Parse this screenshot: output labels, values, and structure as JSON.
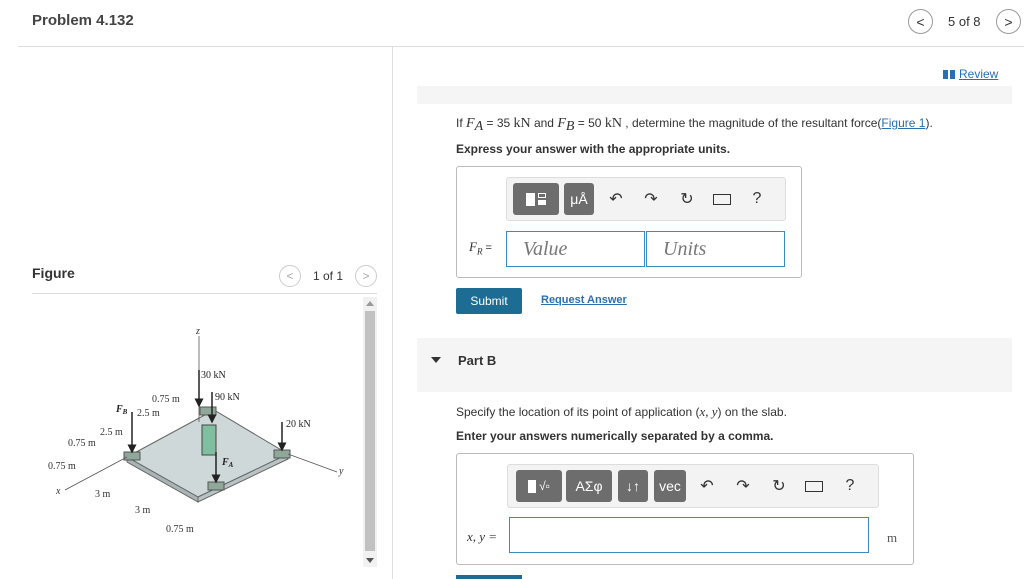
{
  "header": {
    "title": "Problem 4.132",
    "page_indicator": "5 of 8",
    "prev_glyph": "<",
    "next_glyph": ">"
  },
  "figure_panel": {
    "title": "Figure",
    "count": "1 of 1",
    "labels": {
      "z": "z",
      "x": "x",
      "y": "y",
      "f30": "30 kN",
      "f90": "90 kN",
      "f20": "20 kN",
      "fb": "F",
      "fb_sub": "B",
      "fa": "F",
      "fa_sub": "A",
      "d075a": "0.75 m",
      "d25a": "2.5 m",
      "d25b": "2.5 m",
      "d075b": "0.75 m",
      "d075c": "0.75 m",
      "d3a": "3 m",
      "d3b": "3 m",
      "d075d": "0.75 m"
    }
  },
  "review": {
    "label": "Review"
  },
  "part_a": {
    "q_if": "If ",
    "fa_sym": "F",
    "fa_sub": "A",
    "q_eq1": " = 35 ",
    "unit1": "kN",
    "q_and": " and ",
    "fb_sym": "F",
    "fb_sub": "B",
    "q_eq2": " = 50 ",
    "unit2": "kN",
    "q_rest": " , determine the magnitude of the resultant force(",
    "figure_link": "Figure 1",
    "q_end": ").",
    "instruction": "Express your answer with the appropriate units.",
    "field_label_sym": "F",
    "field_label_sub": "R",
    "field_label_eq": " =",
    "value_placeholder": "Value",
    "units_placeholder": "Units",
    "toolbar": {
      "units_btn": "μÅ",
      "help": "?"
    },
    "submit": "Submit",
    "request_answer": "Request Answer"
  },
  "part_b": {
    "title": "Part B",
    "question_pre": "Specify the location of its point of application (",
    "question_vars": "x, y",
    "question_post": ") on the slab.",
    "instruction": "Enter your answers numerically separated by a comma.",
    "field_label": "x, y =",
    "unit": "m",
    "toolbar": {
      "greek": "ΑΣφ",
      "arrows": "↓↑",
      "vec": "vec",
      "help": "?"
    }
  }
}
